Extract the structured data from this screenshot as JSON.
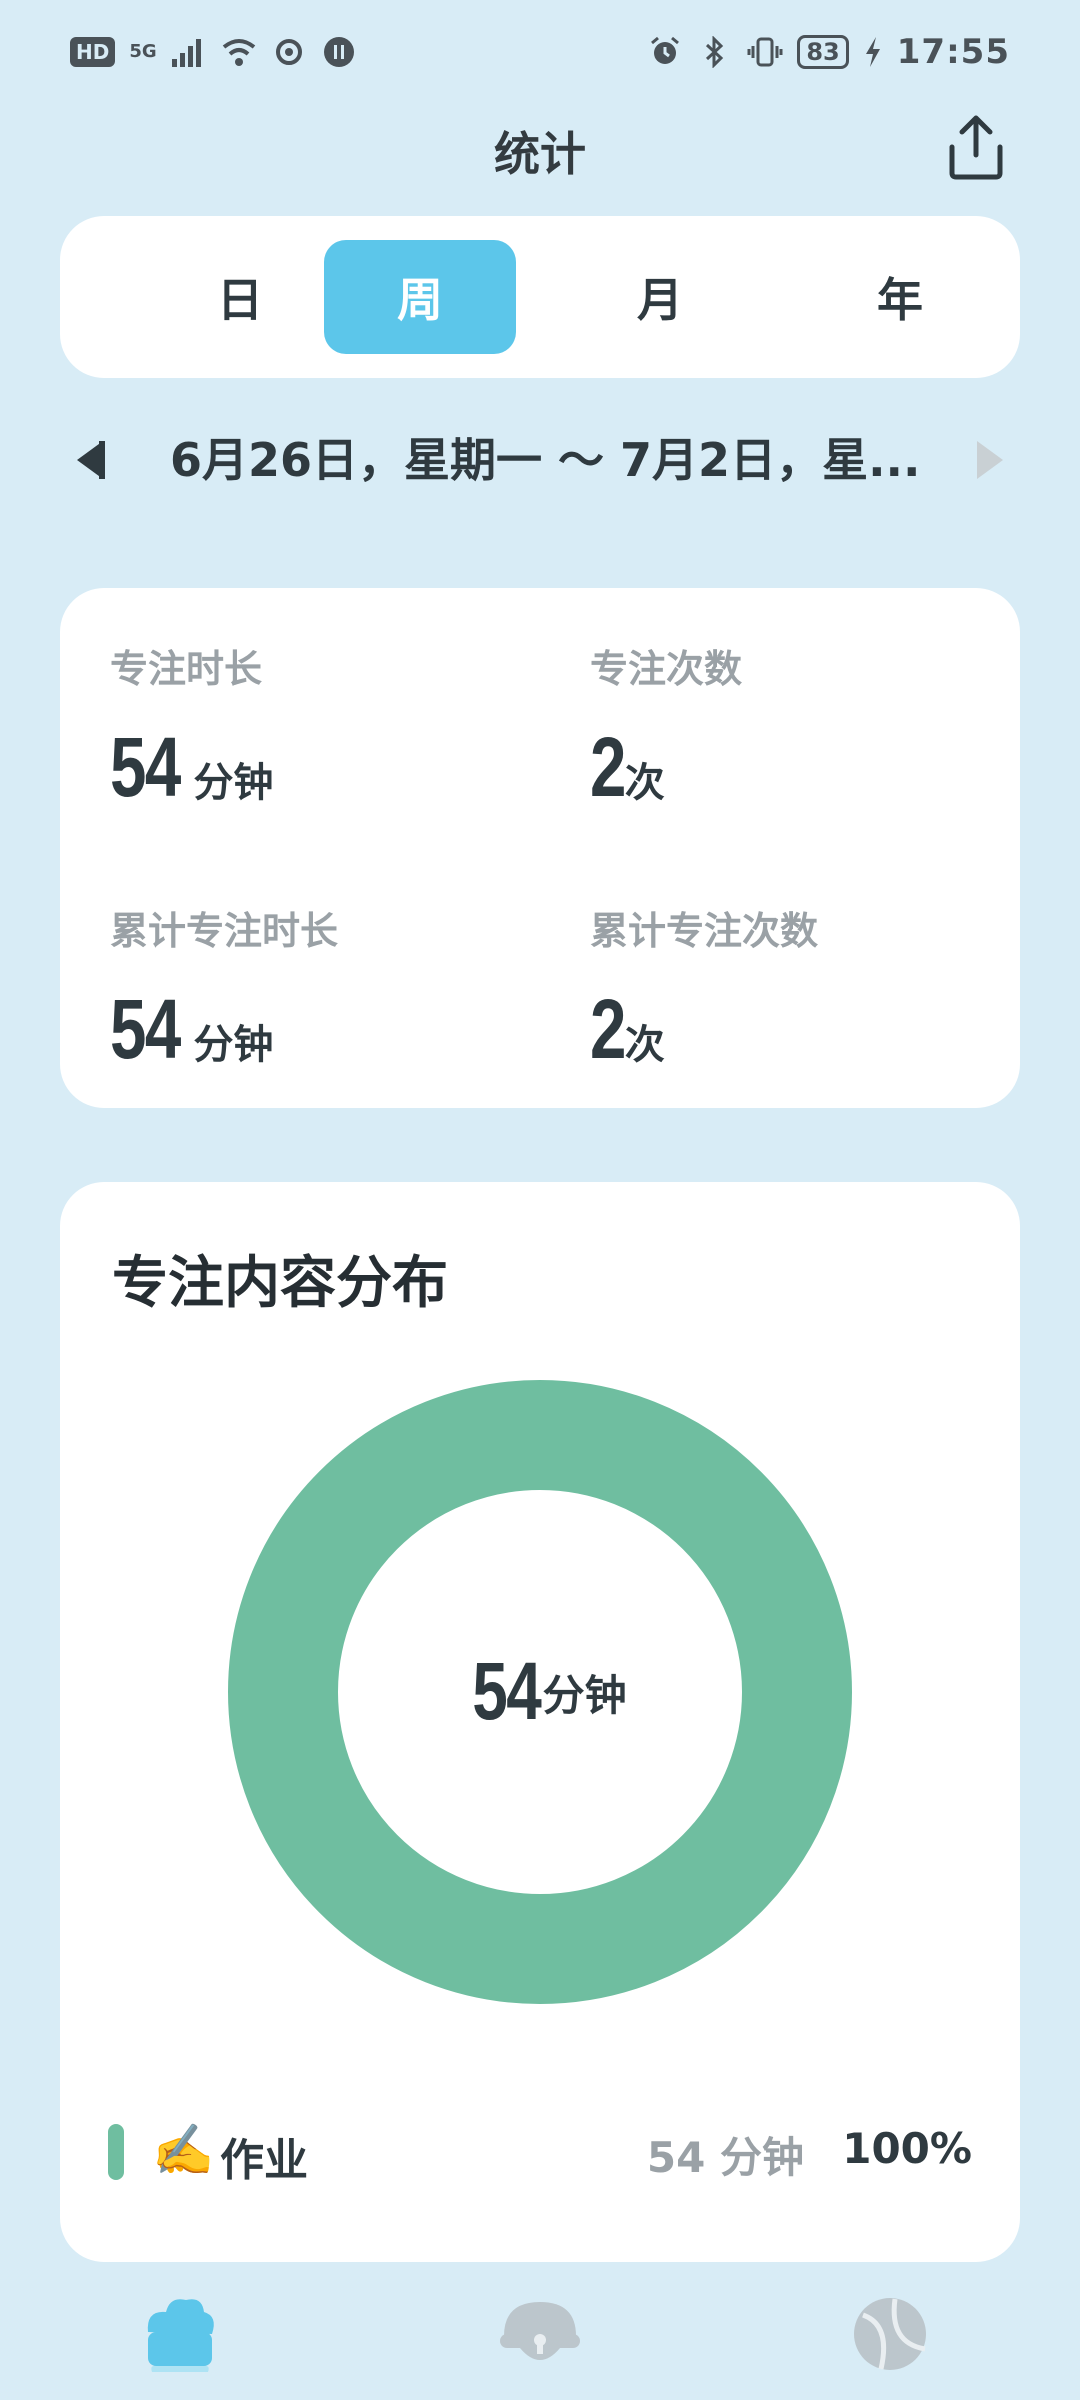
{
  "status_bar": {
    "hd_badge": "HD",
    "network": "5G",
    "battery": "83",
    "time": "17:55",
    "icons": [
      "signal-icon",
      "wifi-icon",
      "sync-icon",
      "pause-icon",
      "alarm-icon",
      "bluetooth-icon",
      "vibrate-icon",
      "charging-icon"
    ]
  },
  "header": {
    "title": "统计",
    "share_icon": "share-icon"
  },
  "period_tabs": {
    "items": [
      {
        "label": "日"
      },
      {
        "label": "周"
      },
      {
        "label": "月"
      },
      {
        "label": "年"
      }
    ],
    "active": "周"
  },
  "date_nav": {
    "range": "6月26日，星期一 ～ 7月2日，星...",
    "prev_icon": "chevron-left-icon",
    "next_icon": "chevron-right-icon"
  },
  "stats": {
    "focus_duration": {
      "label": "专注时长",
      "value": "54",
      "unit": "分钟"
    },
    "focus_count": {
      "label": "专注次数",
      "value": "2",
      "unit": "次"
    },
    "total_duration": {
      "label": "累计专注时长",
      "value": "54",
      "unit": "分钟"
    },
    "total_count": {
      "label": "累计专注次数",
      "value": "2",
      "unit": "次"
    }
  },
  "distribution": {
    "title": "专注内容分布",
    "center_value": "54",
    "center_unit": "分钟",
    "items": [
      {
        "emoji": "✍️",
        "name": "作业",
        "minutes": "54 分钟",
        "percent": "100%",
        "share": 1.0,
        "color": "#6fbea0"
      }
    ]
  },
  "bottom_nav": {
    "items": [
      {
        "name": "statistics-icon",
        "active": true
      },
      {
        "name": "lock-icon",
        "active": false
      },
      {
        "name": "planet-icon",
        "active": false
      }
    ]
  },
  "colors": {
    "background": "#d8ecf6",
    "accent": "#5cc6ea",
    "donut": "#6fbea0",
    "muted_text": "#9aa1a6"
  }
}
